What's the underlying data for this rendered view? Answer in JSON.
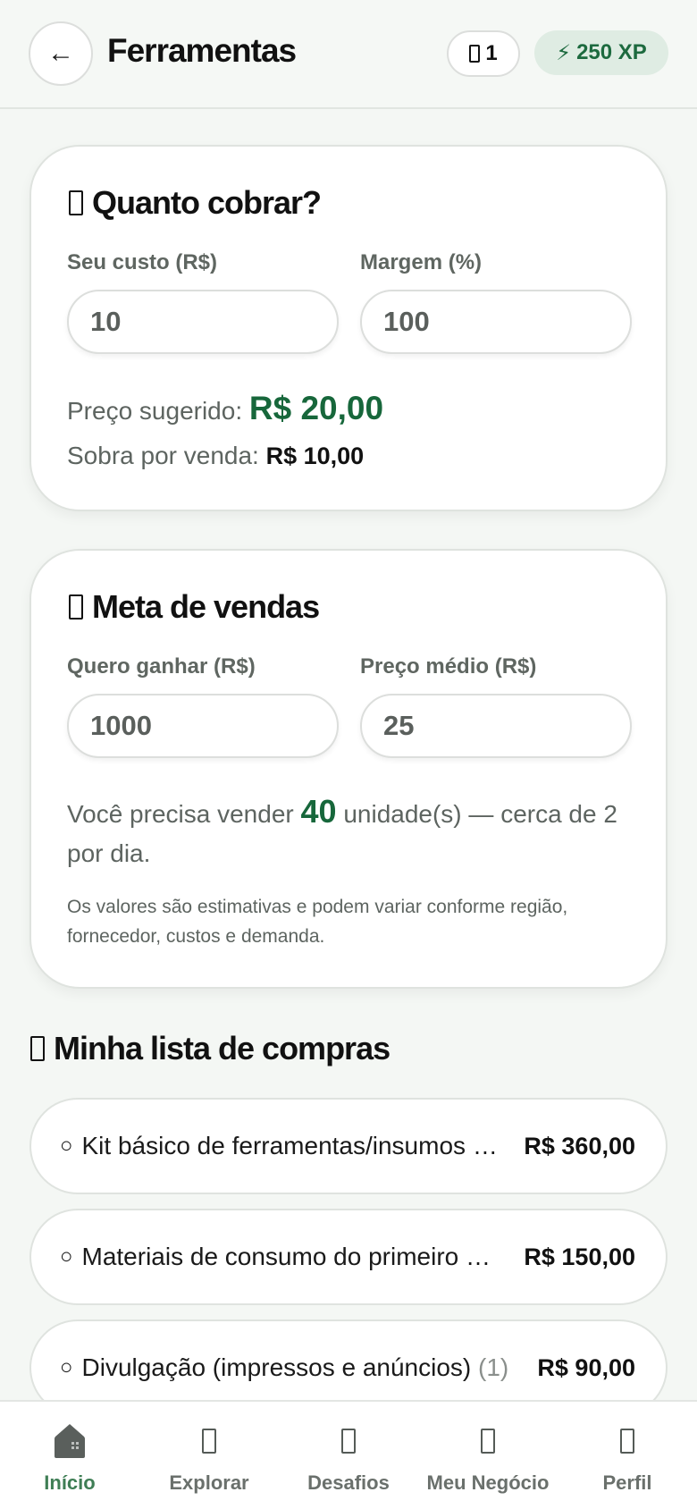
{
  "header": {
    "back_icon": "←",
    "title": "Ferramentas",
    "streak_count": "1",
    "streak_icon": "glyph-box-icon",
    "xp_icon": "⚡",
    "xp_label": "250 XP"
  },
  "price_card": {
    "title": "Quanto cobrar?",
    "cost_label": "Seu custo (R$)",
    "cost_value": "10",
    "margin_label": "Margem (%)",
    "margin_value": "100",
    "suggested_label": "Preço sugerido: ",
    "suggested_value": "R$ 20,00",
    "profit_label": "Sobra por venda: ",
    "profit_value": "R$ 10,00"
  },
  "goal_card": {
    "title": "Meta de vendas",
    "earn_label": "Quero ganhar (R$)",
    "earn_value": "1000",
    "avg_label": "Preço médio (R$)",
    "avg_value": "25",
    "need_prefix": "Você precisa vender ",
    "need_units": "40",
    "need_suffix_1": " unidade(s) — cerca de 2",
    "need_suffix_2": "por dia.",
    "disclaimer": "Os valores são estimativas e podem variar conforme região, fornecedor, custos e demanda."
  },
  "shopping": {
    "title": "Minha lista de compras",
    "items": [
      {
        "check": "○",
        "name": "Kit básico de ferramentas/insumos iniciais",
        "count": "",
        "price": "R$ 360,00"
      },
      {
        "check": "○",
        "name": "Materiais de consumo do primeiro mês",
        "count": "",
        "price": "R$ 150,00"
      },
      {
        "check": "○",
        "name": "Divulgação (impressos e anúncios)",
        "count": "(1)",
        "price": "R$ 90,00"
      }
    ]
  },
  "nav": {
    "items": [
      {
        "label": "Início",
        "icon": "home-icon"
      },
      {
        "label": "Explorar",
        "icon": "explore-icon"
      },
      {
        "label": "Desafios",
        "icon": "challenges-icon"
      },
      {
        "label": "Meu Negócio",
        "icon": "business-icon"
      },
      {
        "label": "Perfil",
        "icon": "profile-icon"
      }
    ]
  },
  "colors": {
    "accent_green": "#17673b",
    "xp_badge_bg": "#dfece3",
    "page_bg": "#f4f7f4"
  }
}
